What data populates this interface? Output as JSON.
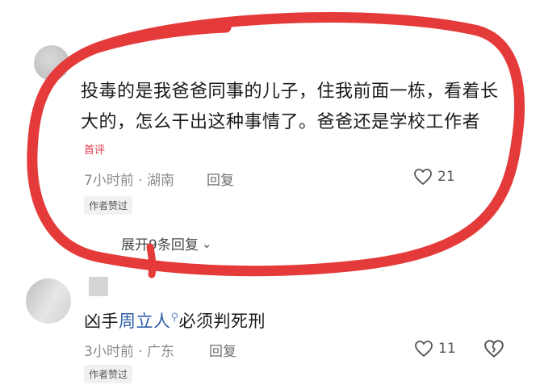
{
  "comment1": {
    "text": "投毒的是我爸爸同事的儿子，住我前面一栋，看着长大的，怎么干出这种事情了。爸爸还是学校工作者",
    "badge": "首评",
    "meta": "7小时前 · 湖南",
    "reply_label": "回复",
    "like_count": "21",
    "author_liked": "作者赞过",
    "expand_label": "展开9条回复"
  },
  "comment2": {
    "text_prefix": "凶手",
    "link_name": "周立人",
    "text_suffix": "必须判死刑",
    "meta": "3小时前 · 广东",
    "reply_label": "回复",
    "like_count": "11",
    "author_liked": "作者赞过"
  },
  "icons": {
    "heart": "heart-icon",
    "dislike": "broken-heart-icon",
    "search": "search-icon",
    "chevron": "chevron-down-icon"
  },
  "colors": {
    "annotation_circle": "#e43a3a",
    "badge": "#e0394a",
    "link": "#2c5ea8"
  }
}
